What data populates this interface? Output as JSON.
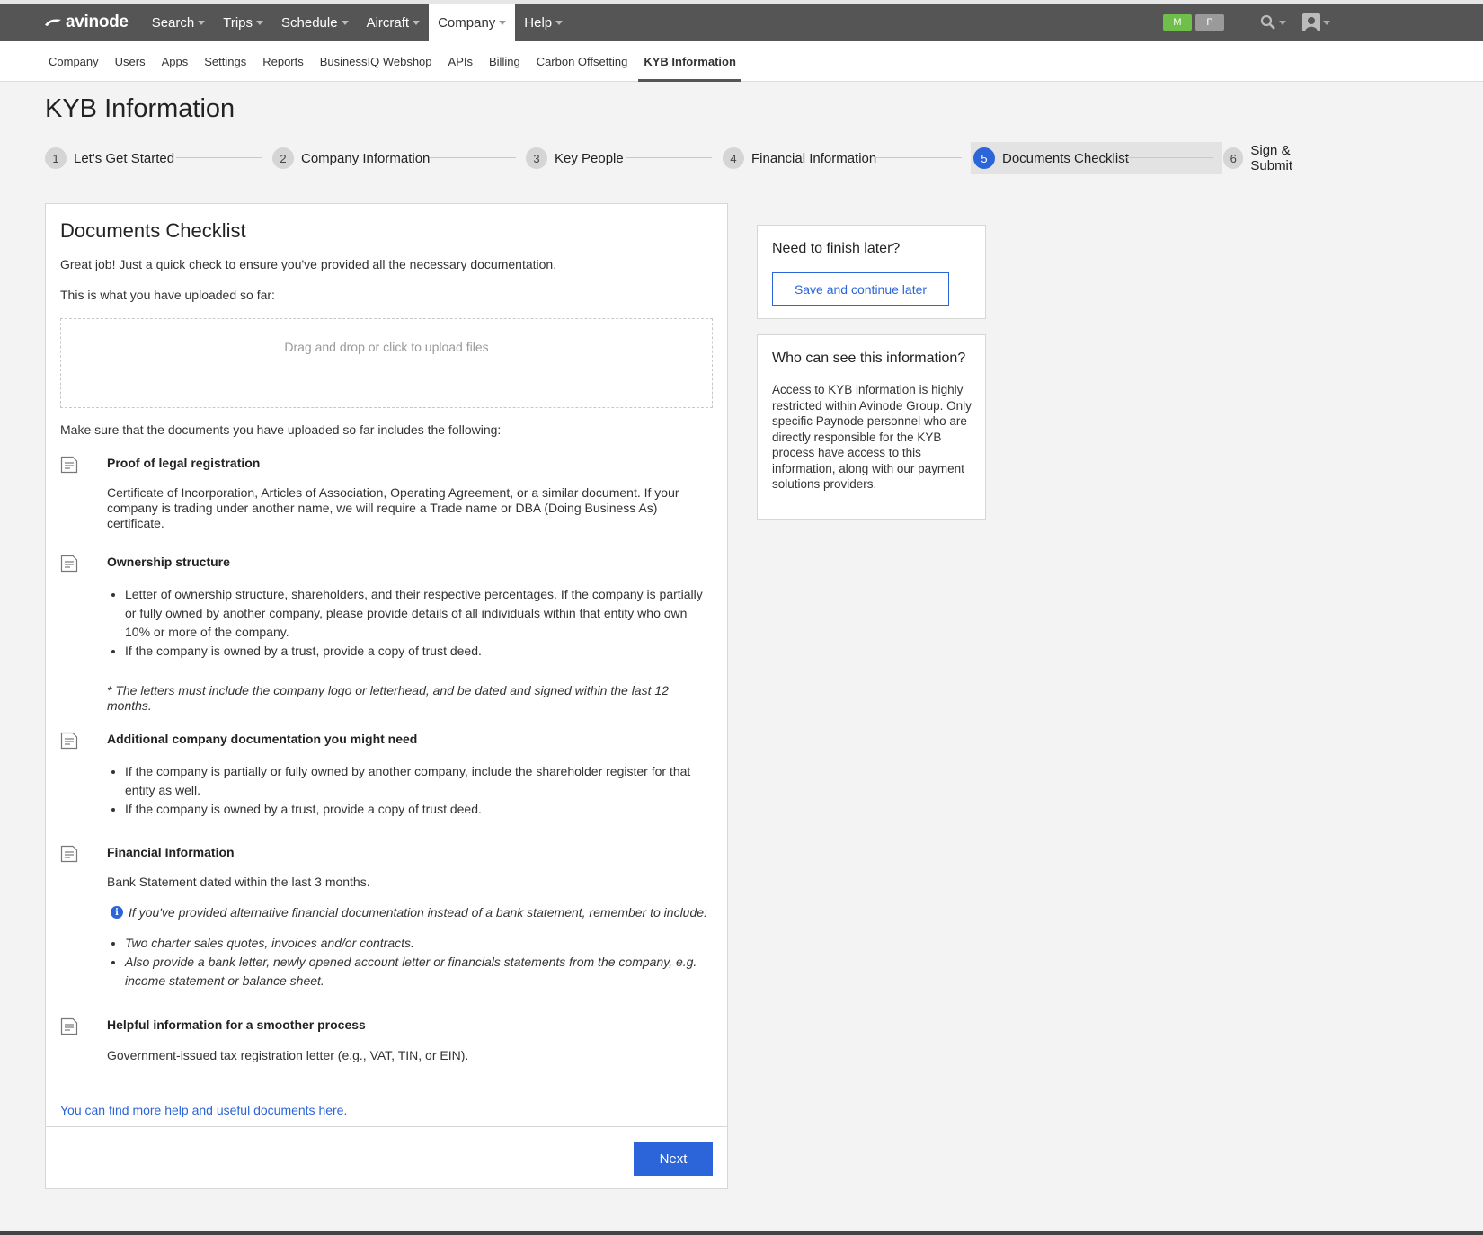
{
  "brand": {
    "name": "avinode"
  },
  "topnav": {
    "items": [
      {
        "label": "Search"
      },
      {
        "label": "Trips"
      },
      {
        "label": "Schedule"
      },
      {
        "label": "Aircraft"
      },
      {
        "label": "Company"
      },
      {
        "label": "Help"
      }
    ],
    "badges": {
      "m": "M",
      "p": "P"
    }
  },
  "subnav": {
    "items": [
      "Company",
      "Users",
      "Apps",
      "Settings",
      "Reports",
      "BusinessIQ Webshop",
      "APIs",
      "Billing",
      "Carbon Offsetting",
      "KYB Information"
    ]
  },
  "page": {
    "title": "KYB Information"
  },
  "steps": [
    {
      "num": "1",
      "label": "Let's Get Started"
    },
    {
      "num": "2",
      "label": "Company Information"
    },
    {
      "num": "3",
      "label": "Key People"
    },
    {
      "num": "4",
      "label": "Financial Information"
    },
    {
      "num": "5",
      "label": "Documents Checklist"
    },
    {
      "num": "6",
      "label": "Sign & Submit"
    }
  ],
  "card": {
    "title": "Documents Checklist",
    "intro": "Great job! Just a quick check to ensure you've provided all the necessary documentation.",
    "uploaded_label": "This is what you have uploaded so far:",
    "dropzone": "Drag and drop or click to upload files",
    "make_sure": "Make sure that the documents you have uploaded so far includes the following:",
    "docs": {
      "legal": {
        "title": "Proof of legal registration",
        "body": "Certificate of Incorporation, Articles of Association, Operating Agreement, or a similar document. If your company is trading under another name, we will require a Trade name or DBA (Doing Business As) certificate."
      },
      "ownership": {
        "title": "Ownership structure",
        "bullets": [
          "Letter of ownership structure, shareholders, and their respective percentages. If the company is partially or fully owned by another company, please provide details of all individuals within that entity who own 10% or more of the company.",
          "If the company is owned by a trust, provide a copy of trust deed."
        ],
        "note": "* The letters must include the company logo or letterhead, and be dated and signed within the last 12 months."
      },
      "additional": {
        "title": "Additional company documentation you might need",
        "bullets": [
          "If the company is partially or fully owned by another company, include the shareholder register for that entity as well.",
          "If the company is owned by a trust, provide a copy of trust deed."
        ]
      },
      "financial": {
        "title": "Financial Information",
        "body": "Bank Statement dated within the last 3 months.",
        "info": "If you've provided alternative financial documentation instead of a bank statement, remember to include:",
        "bullets": [
          "Two charter sales quotes, invoices and/or contracts.",
          "Also provide a bank letter, newly opened account letter or financials statements from the company, e.g. income statement or balance sheet."
        ]
      },
      "helpful": {
        "title": "Helpful information for a smoother process",
        "body": "Government-issued tax registration letter (e.g., VAT, TIN, or EIN)."
      }
    },
    "help_link": "You can find more help and useful documents here.",
    "next_button": "Next"
  },
  "sidebar": {
    "finish_later": {
      "title": "Need to finish later?",
      "button": "Save and continue later"
    },
    "who_can_see": {
      "title": "Who can see this information?",
      "body": "Access to KYB information is highly restricted within Avinode Group. Only specific Paynode personnel who are directly responsible for the KYB process have access to this information, along with our payment solutions providers."
    }
  },
  "colors": {
    "accent": "#2b65d9",
    "topbar": "#555555",
    "badge_m": "#6fbf4a",
    "badge_p": "#9a9a9a"
  },
  "icons": [
    "document-icon",
    "info-icon",
    "search-icon",
    "user-icon"
  ]
}
